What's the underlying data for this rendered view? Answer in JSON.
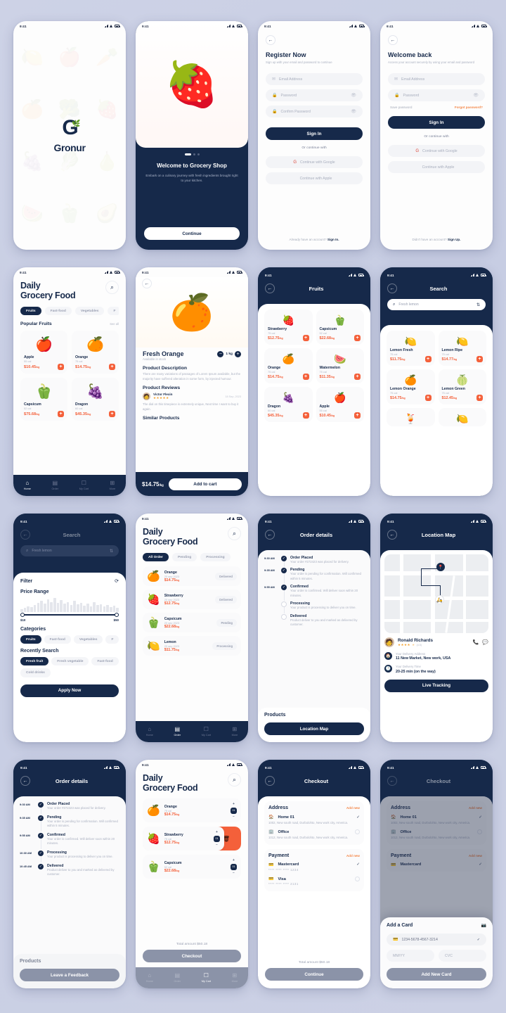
{
  "meta": {
    "status_time": "9:41"
  },
  "brand": {
    "name": "Gronur",
    "accent": "#f4603a",
    "navy": "#16294a"
  },
  "screens": {
    "splash": {
      "name": "Gronur"
    },
    "onboarding": {
      "title": "Welcome to Grocery Shop",
      "subtitle": "Embark on a culinary journey with fresh ingredients brought right to your kitchen.",
      "cta": "Continue"
    },
    "register": {
      "title": "Register Now",
      "subtitle": "Sign up with your email and password to continue",
      "fields": [
        {
          "placeholder": "Email Address",
          "icon": "mail-icon"
        },
        {
          "placeholder": "Password",
          "icon": "lock-icon"
        },
        {
          "placeholder": "Confirm Password",
          "icon": "lock-icon"
        }
      ],
      "submit": "Sign In",
      "divider": "Or continue with",
      "social": [
        {
          "label": "Continue with Google",
          "icon": "google-icon"
        },
        {
          "label": "Continue with Apple",
          "icon": "apple-icon"
        }
      ],
      "footer_text": "Already have an account?",
      "footer_link": "Sign In."
    },
    "login": {
      "title": "Welcome back",
      "subtitle": "Access your account securely by using your email and password",
      "fields": [
        {
          "placeholder": "Email Address",
          "icon": "mail-icon"
        },
        {
          "placeholder": "Password",
          "icon": "lock-icon"
        }
      ],
      "save_password": "Save password",
      "forgot": "Forgot password?",
      "submit": "Sign In",
      "divider": "Or continue with",
      "social": [
        {
          "label": "Continue with Google",
          "icon": "google-icon"
        },
        {
          "label": "Continue with Apple",
          "icon": "apple-icon"
        }
      ],
      "footer_text": "Didn't have an account?",
      "footer_link": "Sign Up."
    },
    "home": {
      "title_line1": "Daily",
      "title_line2": "Grocery Food",
      "categories": [
        "Fruits",
        "Fast-food",
        "Vegetables",
        "F"
      ],
      "section_title": "Popular Fruits",
      "see_all": "See all",
      "products": [
        {
          "name": "Apple",
          "cal": "55 cal",
          "price": "$10.45",
          "unit": "/kg",
          "emoji": "🍎"
        },
        {
          "name": "Orange",
          "cal": "75 cal",
          "price": "$14.75",
          "unit": "/kg",
          "emoji": "🍊"
        },
        {
          "name": "Capsicum",
          "cal": "52 cal",
          "price": "$75.68",
          "unit": "/kg",
          "emoji": "🫑"
        },
        {
          "name": "Dragon",
          "cal": "60 cal",
          "price": "$45.35",
          "unit": "/kg",
          "emoji": "🍇"
        }
      ],
      "nav": [
        {
          "label": "Home",
          "icon": "home-icon",
          "glyph": "⌂"
        },
        {
          "label": "Order",
          "icon": "order-icon",
          "glyph": "▤"
        },
        {
          "label": "My Cart",
          "icon": "cart-icon",
          "glyph": "☑"
        },
        {
          "label": "More",
          "icon": "more-icon",
          "glyph": "⊞"
        }
      ]
    },
    "product": {
      "name": "Fresh Orange",
      "stock": "Available in stock",
      "qty": "1 kg",
      "desc_title": "Product Description",
      "desc": "There are many variations of passages of Lorem Ipsum available, but the majority have suffered alteration in some form, by injected humour.",
      "reviews_title": "Product Reviews",
      "review": {
        "author": "Victor Flexin",
        "date": "18 Sep, 2023",
        "stars": "★★★★★",
        "text": "The dial on this timepiece is extremely unique, Next time I want to buy it again."
      },
      "similar_title": "Similar Products",
      "price": "$14.75",
      "unit": "/kg",
      "cta": "Add to cart"
    },
    "fruits": {
      "title": "Fruits",
      "products": [
        {
          "name": "Strawberry",
          "cal": "75 cal",
          "price": "$12.75",
          "unit": "/kg",
          "emoji": "🍓"
        },
        {
          "name": "Capsicum",
          "cal": "52 cal",
          "price": "$22.68",
          "unit": "/kg",
          "emoji": "🫑"
        },
        {
          "name": "Orange",
          "cal": "75 cal",
          "price": "$14.75",
          "unit": "/kg",
          "emoji": "🍊"
        },
        {
          "name": "Watermelon",
          "cal": "75 cal",
          "price": "$11.35",
          "unit": "/kg",
          "emoji": "🍉"
        },
        {
          "name": "Dragon",
          "cal": "60 cal",
          "price": "$45.35",
          "unit": "/kg",
          "emoji": "🍇"
        },
        {
          "name": "Apple",
          "cal": "55 cal",
          "price": "$10.45",
          "unit": "/kg",
          "emoji": "🍎"
        }
      ]
    },
    "search": {
      "title": "Search",
      "query": "Fresh lemon",
      "products": [
        {
          "name": "Lemon Fresh",
          "cal": "75 cal",
          "price": "$11.75",
          "unit": "/kg",
          "emoji": "🍋"
        },
        {
          "name": "Lemon Ripe",
          "cal": "75 cal",
          "price": "$14.77",
          "unit": "/kg",
          "emoji": "🍋"
        },
        {
          "name": "Lemon Orange",
          "cal": "75 cal",
          "price": "$14.75",
          "unit": "/kg",
          "emoji": "🍊"
        },
        {
          "name": "Lemon Green",
          "cal": "75 cal",
          "price": "$12.45",
          "unit": "/kg",
          "emoji": "🍈"
        },
        {
          "name": "",
          "cal": "",
          "price": "",
          "unit": "",
          "emoji": "🍹"
        },
        {
          "name": "",
          "cal": "",
          "price": "",
          "unit": "",
          "emoji": "🍋"
        }
      ]
    },
    "filter": {
      "header_title": "Search",
      "query": "Fresh lemon",
      "title": "Filter",
      "reset_icon": "refresh-icon",
      "price_title": "Price Range",
      "price_min": "$10",
      "price_max": "$50",
      "histogram": [
        4,
        5,
        7,
        6,
        9,
        12,
        14,
        11,
        16,
        13,
        18,
        12,
        15,
        11,
        13,
        9,
        14,
        10,
        12,
        8,
        11,
        7,
        13,
        9,
        10,
        7,
        9,
        6,
        8,
        5
      ],
      "categories_title": "Categories",
      "categories": [
        "Fruits",
        "Fast-food",
        "Vegetables",
        "F"
      ],
      "recent_title": "Recently Search",
      "recent": [
        "Fresh fruit",
        "Fresh vegetable",
        "Fast-food",
        "Cold drinks"
      ],
      "cta": "Apply Now"
    },
    "orders": {
      "title_line1": "Daily",
      "title_line2": "Grocery Food",
      "tabs": [
        "All Order",
        "Pending",
        "Processing"
      ],
      "items": [
        {
          "name": "Orange",
          "date": "20 sep 2023",
          "price": "$14.75",
          "unit": "/kg",
          "status": "Delivered",
          "emoji": "🍊"
        },
        {
          "name": "Strawberry",
          "date": "20 sep 2023",
          "price": "$12.75",
          "unit": "/kg",
          "status": "Delivered",
          "emoji": "🍓"
        },
        {
          "name": "Capsicum",
          "date": "20 sep 2023",
          "price": "$22.68",
          "unit": "/kg",
          "status": "Pending",
          "emoji": "🫑"
        },
        {
          "name": "Lemon",
          "date": "20 sep 2023",
          "price": "$11.75",
          "unit": "/kg",
          "status": "Processing",
          "emoji": "🍋"
        }
      ]
    },
    "order_details": {
      "title": "Order details",
      "steps": [
        {
          "time": "9:30 AM",
          "label": "Order Placed",
          "desc": "Your order #272423 was placed for delivery.",
          "done": true
        },
        {
          "time": "9:35 AM",
          "label": "Pending",
          "desc": "Your order is pending for confirmation. Will confirmed within 5 minutes.",
          "done": true
        },
        {
          "time": "9:55 AM",
          "label": "Confirmed",
          "desc": "Your order is confirmed. Will deliver soon within 20 minutes.",
          "done": true
        },
        {
          "time": "",
          "label": "Processing",
          "desc": "Your product is processing to deliver you on time.",
          "done": false
        },
        {
          "time": "",
          "label": "Delivered",
          "desc": "Product deliver to you and marked as delivered by customer.",
          "done": false
        }
      ],
      "products_title": "Products",
      "cta": "Location Map"
    },
    "order_details_done": {
      "title": "Order details",
      "steps": [
        {
          "time": "9:30 AM",
          "label": "Order Placed",
          "desc": "Your order #272423 was placed for delivery.",
          "done": true
        },
        {
          "time": "9:35 AM",
          "label": "Pending",
          "desc": "Your order is pending for confirmation. Will confirmed within 5 minutes.",
          "done": true
        },
        {
          "time": "9:55 AM",
          "label": "Confirmed",
          "desc": "Your order is confirmed. Will deliver soon within 20 minutes.",
          "done": true
        },
        {
          "time": "10:30 AM",
          "label": "Processing",
          "desc": "Your product is processing to deliver you on time.",
          "done": true
        },
        {
          "time": "10:45 AM",
          "label": "Delivered",
          "desc": "Product deliver to you and marked as delivered by customer.",
          "done": true
        }
      ],
      "products_title": "Products",
      "cta": "Leave a Feedback"
    },
    "map": {
      "title": "Location Map",
      "driver": "Ronald Richards",
      "rating": "(4.5)",
      "stars": "★★★★",
      "half_star": "★",
      "address_label": "Your Delivery Address",
      "address": "11 New Market, New work, USA",
      "time_label": "Your Delivery Time",
      "time": "20-25 min (on the way)",
      "cta": "Live Tracking",
      "call_icon": "phone-icon",
      "chat_icon": "chat-icon"
    },
    "cart": {
      "title_line1": "Daily",
      "title_line2": "Grocery Food",
      "items": [
        {
          "name": "Orange",
          "cal": "75 cal",
          "price": "$14.75",
          "unit": "/kg",
          "qty": "01",
          "emoji": "🍊",
          "swiped": false
        },
        {
          "name": "Strawberry",
          "cal": "75 cal",
          "price": "$12.75",
          "unit": "/kg",
          "qty": "01",
          "emoji": "🍓",
          "swiped": true
        },
        {
          "name": "Capsicum",
          "cal": "52 cal",
          "price": "$22.68",
          "unit": "/kg",
          "qty": "01",
          "emoji": "🫑",
          "swiped": false
        }
      ],
      "total_label": "Total amount $50.18",
      "cta": "Checkout",
      "delete_icon": "trash-icon"
    },
    "checkout": {
      "title": "Checkout",
      "address_title": "Address",
      "add_new": "Add new",
      "addresses": [
        {
          "label": "Home 01",
          "icon": "home-icon",
          "detail": "1002, New south road, Durbolohto, New work city, America.",
          "selected": true
        },
        {
          "label": "Office",
          "icon": "office-icon",
          "detail": "1012, New south road, Durbolohto, New work city, America.",
          "selected": false
        }
      ],
      "payment_title": "Payment",
      "payments": [
        {
          "label": "Mastercard",
          "number": "**** **** **** 1234",
          "selected": true,
          "icon": "mastercard-icon"
        },
        {
          "label": "Visa",
          "number": "**** **** **** 2131",
          "selected": false,
          "icon": "visa-icon"
        }
      ],
      "total_label": "Total amount $50.18",
      "cta": "Continue"
    },
    "add_card": {
      "title": "Checkout",
      "modal_title": "Add a Card",
      "scan_icon": "camera-icon",
      "card_number": "1234-5678-4567-3214",
      "expiry_placeholder": "MM/YY",
      "cvc_placeholder": "CVC",
      "cta": "Add New Card"
    }
  }
}
